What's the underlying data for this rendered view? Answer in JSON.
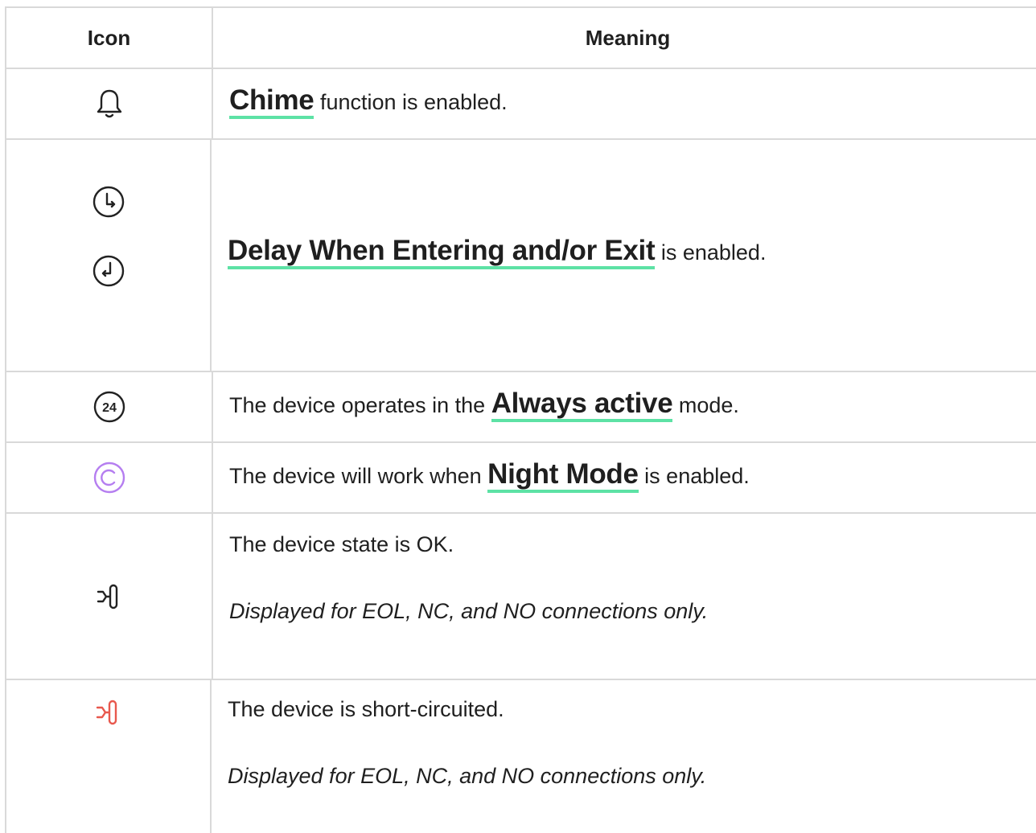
{
  "header": {
    "icon_col": "Icon",
    "meaning_col": "Meaning"
  },
  "rows": [
    {
      "icon": "bell-icon",
      "link": "Chime",
      "after": " function is enabled."
    },
    {
      "icons": [
        "clock-enter-icon",
        "clock-exit-icon"
      ],
      "link": "Delay When Entering and/or Exit",
      "after": " is enabled."
    },
    {
      "icon": "always-active-24-icon",
      "before": "The device operates in the ",
      "link": "Always active",
      "after": " mode."
    },
    {
      "icon": "night-mode-icon",
      "icon_color": "#b57ef0",
      "before": "The device will work when ",
      "link": "Night Mode",
      "after": " is enabled."
    },
    {
      "icon": "connection-ok-icon",
      "text": "The device state is OK.",
      "note": "Displayed for EOL, NC, and NO connections only."
    },
    {
      "icon": "short-circuit-icon",
      "icon_color": "#e8584d",
      "text": "The device is short-circuited.",
      "note": "Displayed for EOL, NC, and NO connections only."
    }
  ],
  "colors": {
    "link_underline": "#5de2a5",
    "border": "#d9d9d9",
    "text": "#1f1f1f"
  }
}
